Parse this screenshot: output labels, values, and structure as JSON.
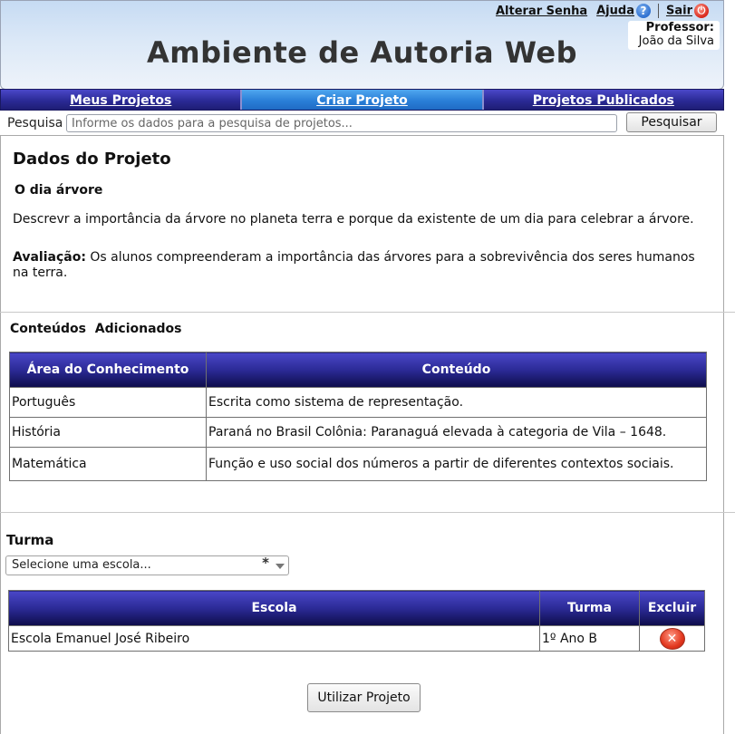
{
  "header": {
    "app_title": "Ambiente de Autoria Web",
    "links": {
      "change_password": "Alterar Senha",
      "help": "Ajuda",
      "exit": "Sair"
    },
    "professor_label": "Professor:",
    "professor_name": "João da Silva"
  },
  "nav": {
    "items": [
      {
        "label": "Meus Projetos"
      },
      {
        "label": "Criar Projeto",
        "active": true
      },
      {
        "label": "Projetos Publicados"
      }
    ]
  },
  "search": {
    "label": "Pesquisa",
    "placeholder": "Informe os dados para a pesquisa de projetos...",
    "button": "Pesquisar"
  },
  "project": {
    "section_title": "Dados do Projeto",
    "name": "O dia árvore",
    "description": "Descrevr a importância da árvore no planeta terra e porque da existente de um dia para celebrar a árvore.",
    "evaluation_label": "Avaliação:",
    "evaluation_text": " Os alunos compreenderam a importância das árvores para a sobrevivência dos seres humanos na terra."
  },
  "contents": {
    "title": "Conteúdos  Adicionados",
    "columns": [
      "Área do Conhecimento",
      "Conteúdo"
    ],
    "rows": [
      [
        "Português",
        "Escrita como sistema de representação."
      ],
      [
        "História",
        "Paraná no Brasil Colônia: Paranaguá elevada à categoria de Vila – 1648."
      ],
      [
        "Matemática",
        "Função e uso social dos números a partir de diferentes contextos sociais."
      ]
    ]
  },
  "turma": {
    "title": "Turma",
    "select_placeholder": "Selecione uma escola...",
    "required_mark": "*",
    "columns": [
      "Escola",
      "Turma",
      "Excluir"
    ],
    "rows": [
      [
        "Escola Emanuel José Ribeiro",
        "1º Ano B"
      ]
    ]
  },
  "actions": {
    "use_project": "Utilizar Projeto"
  },
  "colors": {
    "nav_blue": "#2b2a96",
    "nav_active": "#2a7fd8",
    "header_bg": "#c6dbf3",
    "delete_red": "#e2381f"
  },
  "icons": {
    "help": "help-icon",
    "exit": "power-icon",
    "delete": "delete-icon",
    "dropdown": "chevron-down-icon"
  }
}
